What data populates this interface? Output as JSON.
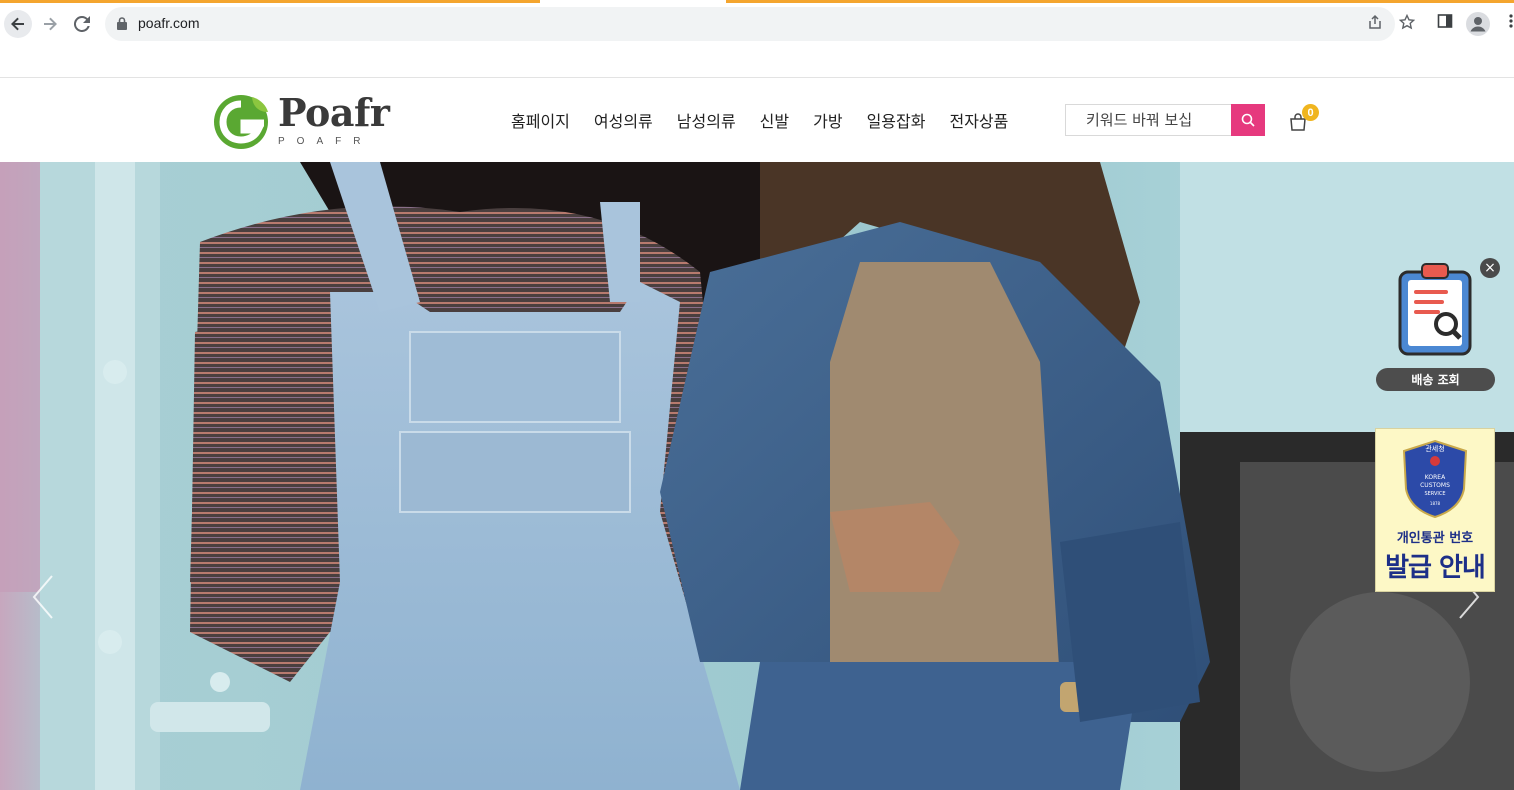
{
  "browser": {
    "url": "poafr.com"
  },
  "site": {
    "logo_word": "Poafr",
    "logo_sub": "POAFR"
  },
  "nav": {
    "items": [
      "홈페이지",
      "여성의류",
      "남성의류",
      "신발",
      "가방",
      "일용잡화",
      "전자상품"
    ]
  },
  "search": {
    "placeholder": "키워드 바꿔 보십"
  },
  "cart": {
    "count": "0"
  },
  "widgets": {
    "tracking_label": "배송 조회",
    "customs_line1": "개인통관 번호",
    "customs_line2": "발급 안내",
    "customs_badge_top": "관세청",
    "customs_badge_text": "KOREA CUSTOMS SERVICE",
    "customs_badge_year": "1878"
  },
  "colors": {
    "accent": "#e6397e",
    "badge": "#f0b51f",
    "logo_green": "#5aa832",
    "load_bar": "#f4a52e",
    "customs_blue": "#1d2f88"
  }
}
